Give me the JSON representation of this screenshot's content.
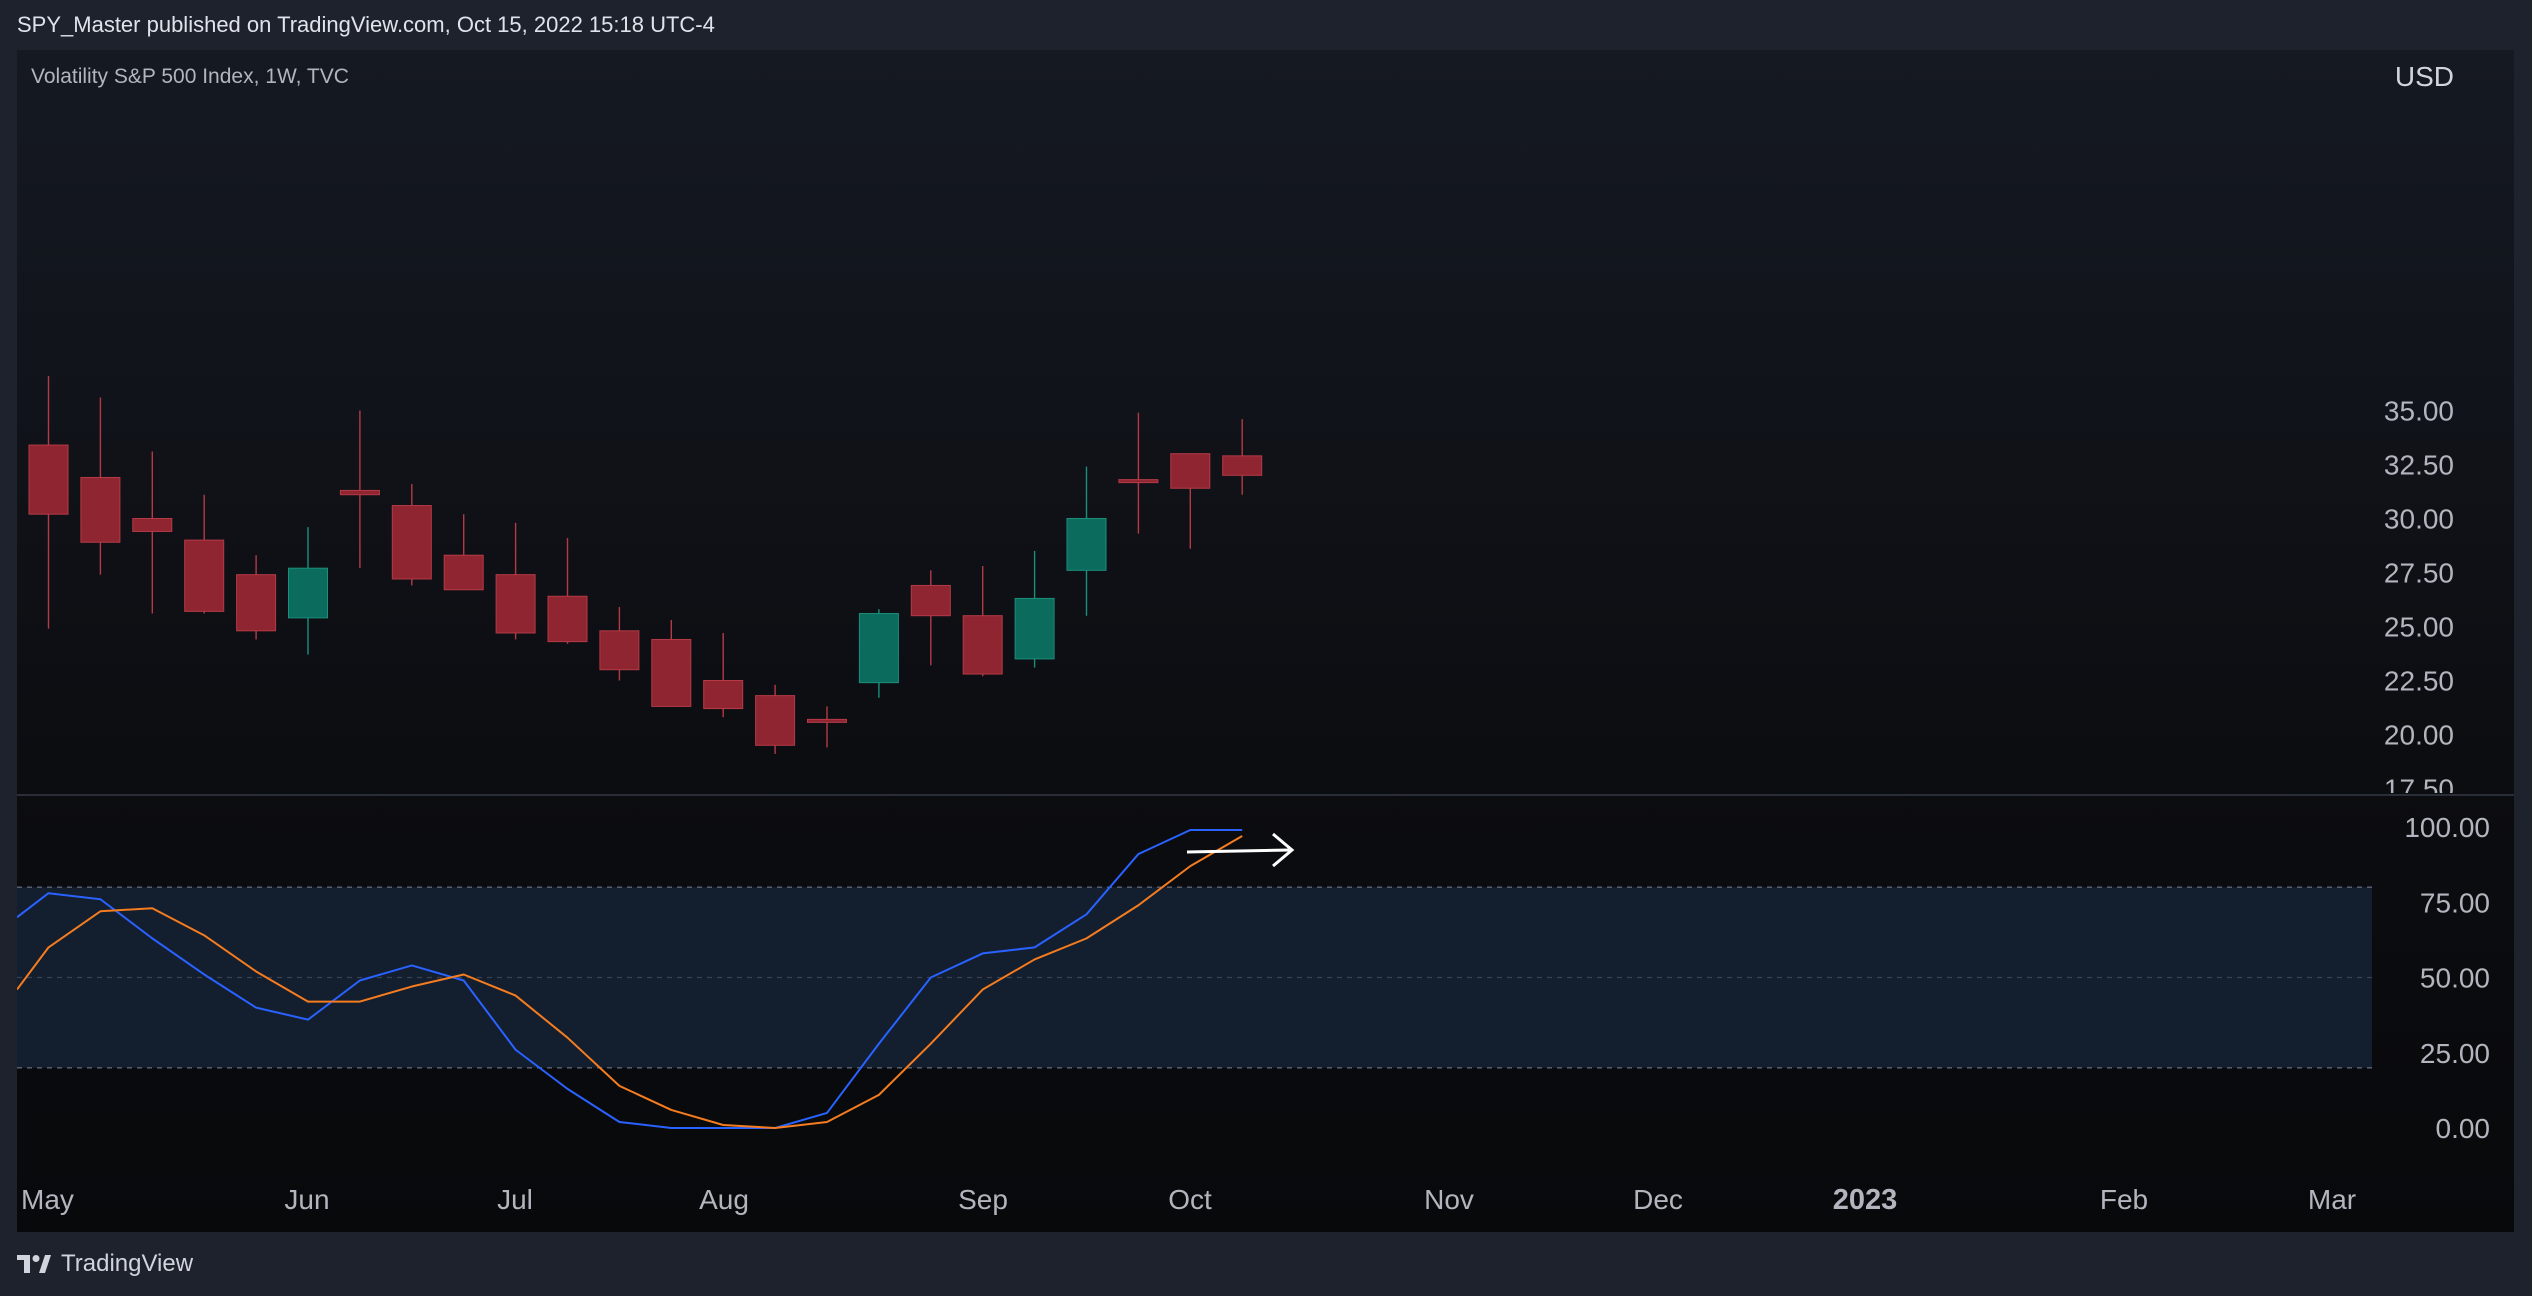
{
  "header": {
    "published_line": "SPY_Master published on TradingView.com, Oct 15, 2022 15:18 UTC-4"
  },
  "footer": {
    "logo_text": "TradingView"
  },
  "chart_data": [
    {
      "type": "candlestick",
      "symbol_label": "Volatility S&P 500 Index, 1W, TVC",
      "currency": "USD",
      "ylim": [
        17.5,
        37.5
      ],
      "y_ticks": [
        "35.00",
        "32.50",
        "30.00",
        "27.50",
        "25.00",
        "22.50",
        "20.00",
        "17.50"
      ],
      "x_tick_labels": [
        "May",
        "Jun",
        "Jul",
        "Aug",
        "Sep",
        "Oct",
        "Nov",
        "Dec",
        "2023",
        "Feb",
        "Mar"
      ],
      "colors": {
        "up": "#0b6b5d",
        "down": "#8e2531",
        "up_wick": "#1b8e7c",
        "down_wick": "#b53a46"
      },
      "candles": [
        {
          "week": "2022-04-29",
          "open": 33.4,
          "high": 36.6,
          "low": 24.9,
          "close": 30.2
        },
        {
          "week": "2022-05-06",
          "open": 31.9,
          "high": 35.6,
          "low": 27.4,
          "close": 28.9
        },
        {
          "week": "2022-05-13",
          "open": 30.0,
          "high": 33.1,
          "low": 25.6,
          "close": 29.4
        },
        {
          "week": "2022-05-20",
          "open": 29.0,
          "high": 31.1,
          "low": 25.6,
          "close": 25.7
        },
        {
          "week": "2022-05-27",
          "open": 27.4,
          "high": 28.3,
          "low": 24.4,
          "close": 24.8
        },
        {
          "week": "2022-06-03",
          "open": 25.4,
          "high": 29.6,
          "low": 23.7,
          "close": 27.7
        },
        {
          "week": "2022-06-10",
          "open": 31.3,
          "high": 35.0,
          "low": 27.7,
          "close": 31.1
        },
        {
          "week": "2022-06-17",
          "open": 30.6,
          "high": 31.6,
          "low": 26.9,
          "close": 27.2
        },
        {
          "week": "2022-06-24",
          "open": 28.3,
          "high": 30.2,
          "low": 26.7,
          "close": 26.7
        },
        {
          "week": "2022-07-01",
          "open": 27.4,
          "high": 29.8,
          "low": 24.4,
          "close": 24.7
        },
        {
          "week": "2022-07-08",
          "open": 26.4,
          "high": 29.1,
          "low": 24.2,
          "close": 24.3
        },
        {
          "week": "2022-07-15",
          "open": 24.8,
          "high": 25.9,
          "low": 22.5,
          "close": 23.0
        },
        {
          "week": "2022-07-22",
          "open": 24.4,
          "high": 25.3,
          "low": 21.3,
          "close": 21.3
        },
        {
          "week": "2022-07-29",
          "open": 22.5,
          "high": 24.7,
          "low": 20.8,
          "close": 21.2
        },
        {
          "week": "2022-08-05",
          "open": 21.8,
          "high": 22.3,
          "low": 19.1,
          "close": 19.5
        },
        {
          "week": "2022-08-12",
          "open": 20.7,
          "high": 21.3,
          "low": 19.4,
          "close": 20.6
        },
        {
          "week": "2022-08-19",
          "open": 22.4,
          "high": 25.8,
          "low": 21.7,
          "close": 25.6
        },
        {
          "week": "2022-08-26",
          "open": 26.9,
          "high": 27.6,
          "low": 23.2,
          "close": 25.5
        },
        {
          "week": "2022-09-02",
          "open": 25.5,
          "high": 27.8,
          "low": 22.7,
          "close": 22.8
        },
        {
          "week": "2022-09-09",
          "open": 23.5,
          "high": 28.5,
          "low": 23.1,
          "close": 26.3
        },
        {
          "week": "2022-09-16",
          "open": 27.6,
          "high": 32.4,
          "low": 25.5,
          "close": 30.0
        },
        {
          "week": "2022-09-23",
          "open": 31.8,
          "high": 34.9,
          "low": 29.3,
          "close": 31.7
        },
        {
          "week": "2022-09-30",
          "open": 33.0,
          "high": 33.0,
          "low": 28.6,
          "close": 31.4
        },
        {
          "week": "2022-10-07",
          "open": 32.9,
          "high": 34.6,
          "low": 31.1,
          "close": 32.0
        }
      ]
    },
    {
      "type": "line",
      "ylim": [
        0,
        100
      ],
      "y_ticks": [
        "100.00",
        "75.00",
        "50.00",
        "25.00",
        "0.00"
      ],
      "band": [
        20,
        80
      ],
      "band_midline": 50,
      "series": [
        {
          "color": "#2962ff",
          "values": [
            70,
            78,
            76,
            63,
            51,
            40,
            36,
            49,
            54,
            49,
            26,
            13,
            2,
            0,
            0,
            0,
            5,
            28,
            50,
            58,
            60,
            71,
            91,
            99,
            99
          ]
        },
        {
          "color": "#f57c1f",
          "values": [
            46,
            60,
            72,
            73,
            64,
            52,
            42,
            42,
            47,
            51,
            44,
            30,
            14,
            6,
            1,
            0,
            2,
            11,
            28,
            46,
            56,
            63,
            74,
            87,
            97
          ]
        }
      ],
      "arrow_color": "#ffffff"
    }
  ]
}
